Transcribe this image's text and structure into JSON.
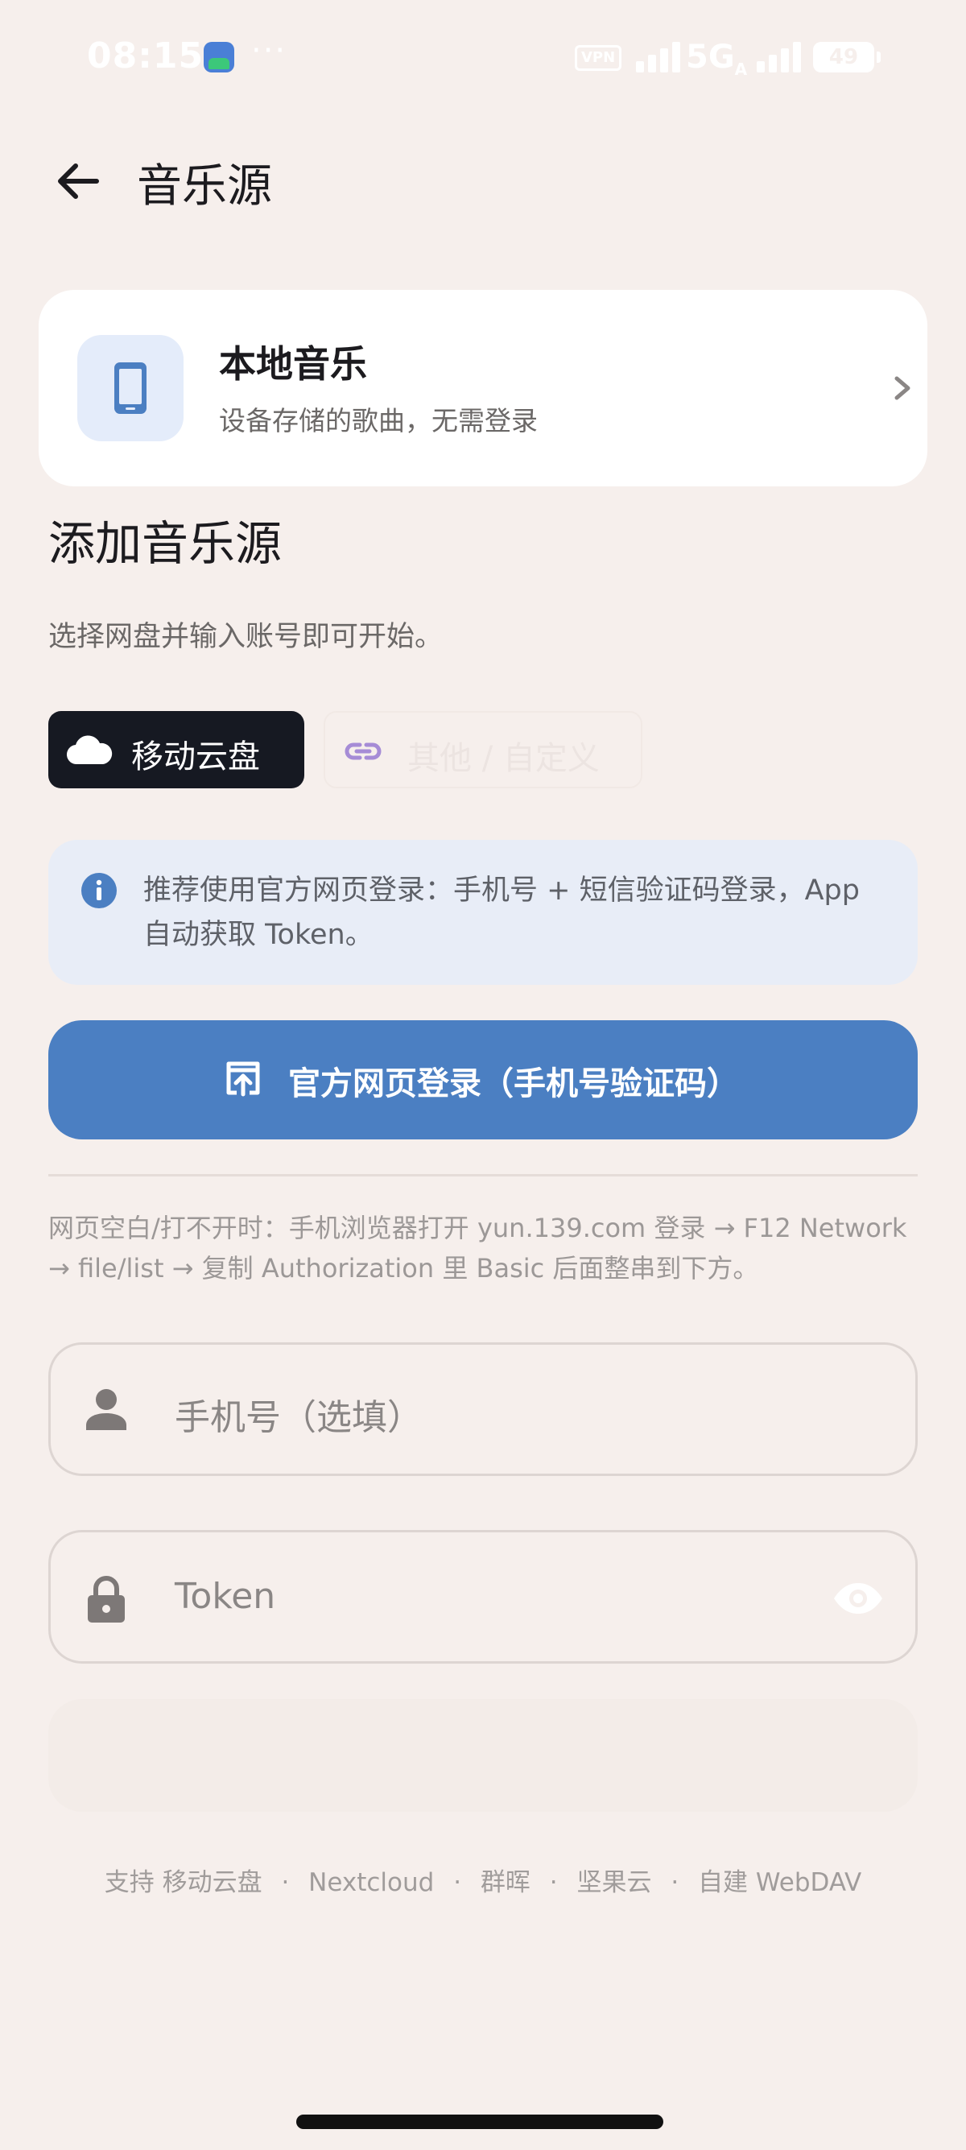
{
  "status_bar": {
    "time": "08:15",
    "dots": "···",
    "vpn": "VPN",
    "network": "5G",
    "network_sub": "A",
    "battery": "49"
  },
  "header": {
    "title": "音乐源"
  },
  "local_card": {
    "title": "本地音乐",
    "subtitle": "设备存储的歌曲，无需登录"
  },
  "add_source": {
    "title": "添加音乐源",
    "subtitle": "选择网盘并输入账号即可开始。",
    "chips": [
      {
        "label": "移动云盘",
        "selected": true
      },
      {
        "label": "其他 / 自定义",
        "selected": false
      }
    ]
  },
  "info": {
    "text": "推荐使用官方网页登录：手机号 + 短信验证码登录，App 自动获取 Token。"
  },
  "login_button": {
    "label": "官方网页登录（手机号验证码）"
  },
  "hint": {
    "text": "网页空白/打不开时：手机浏览器打开 yun.139.com 登录 → F12 Network → file/list → 复制 Authorization 里 Basic 后面整串到下方。"
  },
  "form": {
    "phone_placeholder": "手机号（选填）",
    "token_placeholder": "Token"
  },
  "footer": {
    "prefix": "支持",
    "providers": [
      "移动云盘",
      "Nextcloud",
      "群晖",
      "坚果云",
      "自建 WebDAV"
    ],
    "separator": "·"
  },
  "colors": {
    "background": "#f6efec",
    "primary": "#4b7fc2",
    "chip_active": "#161922",
    "info_bg": "#e8edf7"
  }
}
